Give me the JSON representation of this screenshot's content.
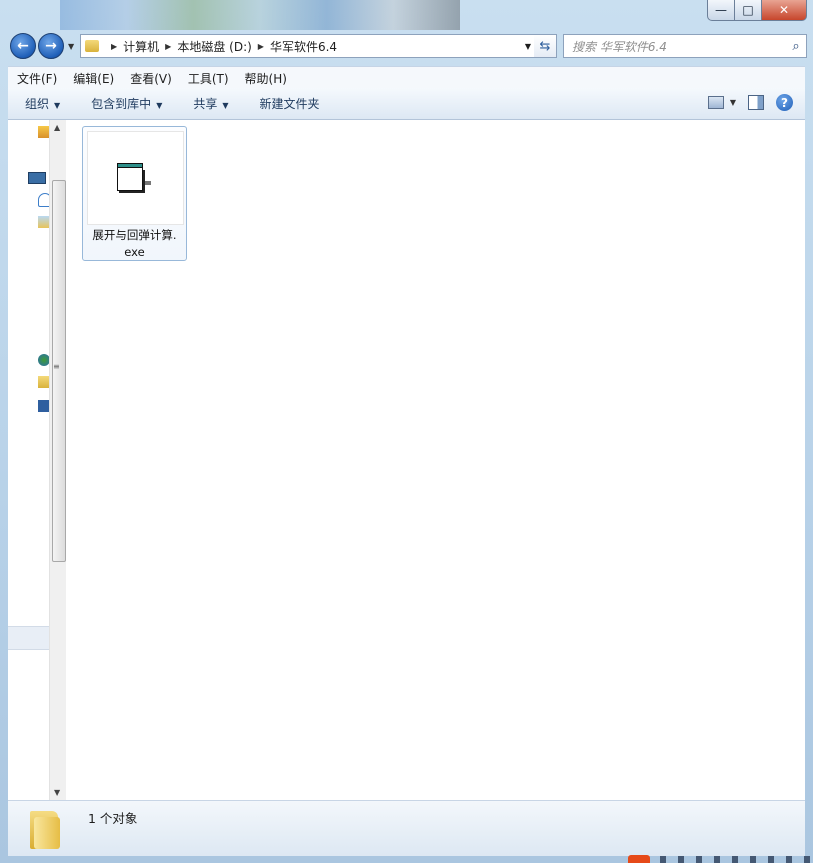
{
  "window": {
    "caption": {
      "minimize": "—",
      "maximize": "□",
      "close": "✕"
    }
  },
  "nav": {
    "back": "←",
    "forward": "→",
    "recent_dropdown": "▼",
    "breadcrumbs": [
      "计算机",
      "本地磁盘 (D:)",
      "华军软件6.4"
    ],
    "address_dropdown": "▼",
    "refresh": "⇆",
    "search_placeholder": "搜索 华军软件6.4",
    "search_icon": "⌕"
  },
  "menubar": {
    "items": [
      "文件(F)",
      "编辑(E)",
      "查看(V)",
      "工具(T)",
      "帮助(H)"
    ]
  },
  "toolbar": {
    "organize": "组织",
    "include_in_library": "包含到库中",
    "share": "共享",
    "new_folder": "新建文件夹",
    "dropdown_arrow": "▼",
    "help": "?"
  },
  "scrollbar": {
    "up": "▲",
    "down": "▼",
    "grip": "≡"
  },
  "files": [
    {
      "name_line1": "展开与回弹计算.",
      "name_line2": "exe",
      "icon": "exe-icon"
    }
  ],
  "status": {
    "item_count": "1 个对象"
  }
}
